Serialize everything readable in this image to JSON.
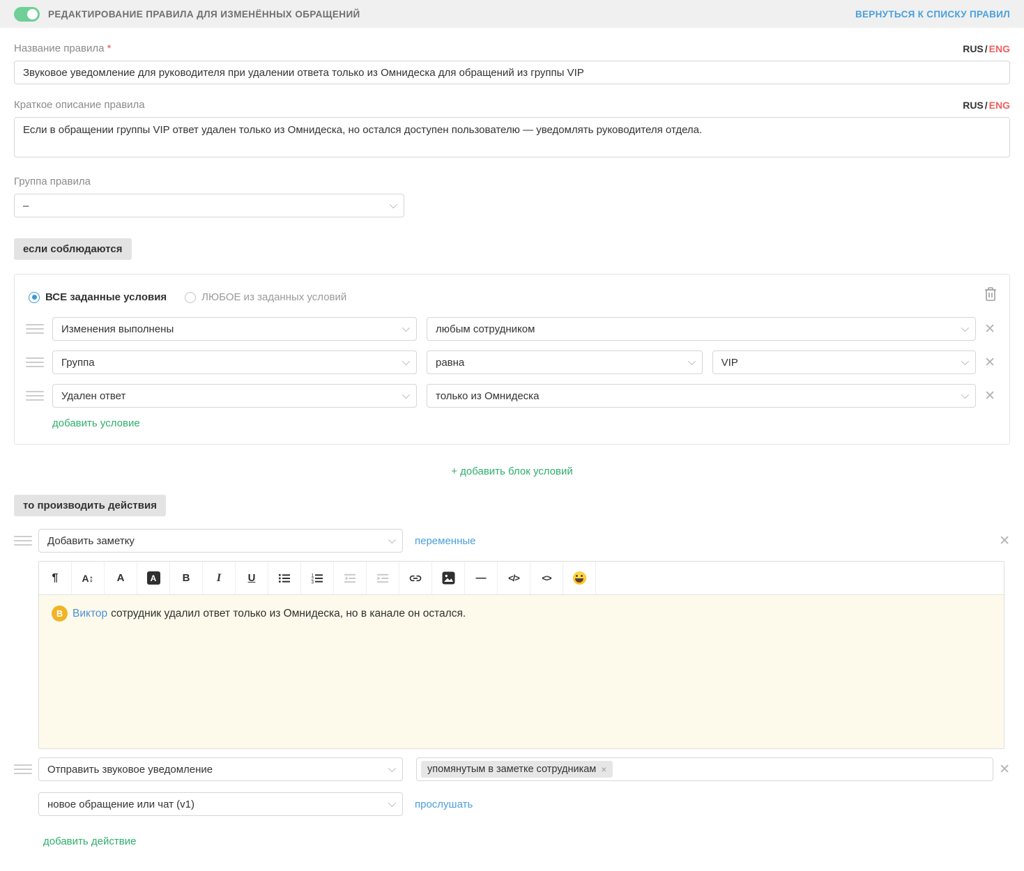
{
  "header": {
    "title": "РЕДАКТИРОВАНИЕ ПРАВИЛА ДЛЯ ИЗМЕНЁННЫХ ОБРАЩЕНИЙ",
    "back_link": "ВЕРНУТЬСЯ К СПИСКУ ПРАВИЛ",
    "toggle_state": "on"
  },
  "lang_switcher": {
    "rus": "RUS",
    "separator": "/",
    "eng": "ENG"
  },
  "name_field": {
    "label": "Название правила",
    "required_mark": "*",
    "value": "Звуковое уведомление для руководителя при удалении ответа только из Омнидеска для обращений из группы VIP"
  },
  "description_field": {
    "label": "Краткое описание правила",
    "value": "Если в обращении группы VIP ответ удален только из Омнидеска, но остался доступен пользователю — уведомлять руководителя отдела."
  },
  "group_field": {
    "label": "Группа правила",
    "value": "–"
  },
  "conditions": {
    "chip": "если соблюдаются",
    "match_all_label": "ВСЕ заданные условия",
    "match_any_label": "ЛЮБОЕ из заданных условий",
    "rows": [
      {
        "field": "Изменения выполнены",
        "operator": "любым сотрудником"
      },
      {
        "field": "Группа",
        "operator": "равна",
        "value": "VIP"
      },
      {
        "field": "Удален ответ",
        "operator": "только из Омнидеска"
      }
    ],
    "add_condition_link": "добавить условие",
    "add_block_link": "+ добавить блок условий"
  },
  "actions": {
    "chip": "то производить действия",
    "action1": {
      "type": "Добавить заметку",
      "variables_link": "переменные"
    },
    "note_editor": {
      "mention_initial": "В",
      "mention_name": "Виктор",
      "note_text": "сотрудник удалил ответ только из Омнидеска, но в канале он остался."
    },
    "action2": {
      "type": "Отправить звуковое уведомление",
      "recipient_tag": "упомянутым в заметке сотрудникам",
      "tag_remove": "×"
    },
    "sound": {
      "value": "новое обращение или чат (v1)",
      "listen_link": "прослушать"
    },
    "add_action_link": "добавить действие",
    "remove_icon": "✕"
  },
  "toolbar": [
    {
      "name": "paragraph-icon",
      "glyph": "¶"
    },
    {
      "name": "font-size-icon",
      "glyph": "A↕"
    },
    {
      "name": "font-color-icon",
      "glyph": "A"
    },
    {
      "name": "highlight-color-icon",
      "glyph": "A"
    },
    {
      "name": "bold-icon",
      "glyph": "B"
    },
    {
      "name": "italic-icon",
      "glyph": "I"
    },
    {
      "name": "underline-icon",
      "glyph": "U"
    },
    {
      "name": "bullet-list-icon"
    },
    {
      "name": "ordered-list-icon"
    },
    {
      "name": "outdent-icon",
      "disabled": true
    },
    {
      "name": "indent-icon",
      "disabled": true
    },
    {
      "name": "link-icon"
    },
    {
      "name": "image-icon"
    },
    {
      "name": "horizontal-rule-icon",
      "glyph": "—"
    },
    {
      "name": "code-block-icon",
      "glyph": "</>"
    },
    {
      "name": "inline-code-icon",
      "glyph": "<>"
    },
    {
      "name": "emoji-icon"
    }
  ],
  "colors": {
    "toggle_green": "#6fcf97",
    "link_blue": "#4a9fd9",
    "green_link": "#2eae6c",
    "eng_red": "#f05f5f",
    "note_bg": "#fdfaeb",
    "avatar_orange": "#f0b429",
    "chip_bg": "#e3e3e3"
  }
}
